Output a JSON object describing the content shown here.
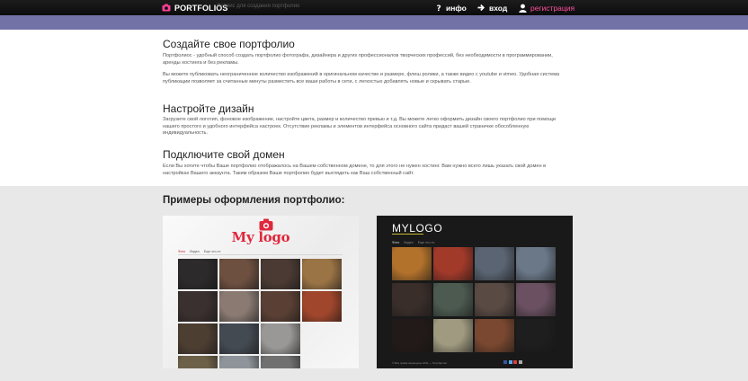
{
  "header": {
    "brand": "PORTFOLIOS",
    "tagline": "Сервис для создания портфолио",
    "nav": [
      {
        "label": "инфо",
        "icon": "question-icon"
      },
      {
        "label": "вход",
        "icon": "arrow-right-icon"
      },
      {
        "label": "регистрация",
        "icon": "user-icon"
      }
    ],
    "colors": {
      "topbar": "#111111",
      "band": "#7372a7",
      "register": "#ff4fa0"
    }
  },
  "sections": [
    {
      "title": "Создайте свое портфолио",
      "paragraphs": [
        "Портфолиос - удобный способ создать портфолио фотографа, дизайнера и других профессионалов творческих профессий, без необходимости в программировании, аренды хостинга и без рекламы.",
        "Вы можете публиковать неограниченное количество изображений в оригинальном качестве и размере, флеш ролики, а также видео с youtube и vimeo. Удобная система публикации позволяет за считанные минуты разместить все ваши работы в сети, с легкостью добавлять новые и скрывать старые."
      ]
    },
    {
      "title": "Настройте дизайн",
      "paragraphs": [
        "Загрузите свой логотип, фоновое изображение, настройте цвета, размер и количество превью и т.д. Вы можете легко оформить дизайн своего портфолио при помощи нашего простого и удобного интерфейса настроек. Отсутствие рекламы и элементов интерфейса основного сайта придаст вашей страничке обособленную индивидуальность."
      ]
    },
    {
      "title": "Подключите свой домен",
      "paragraphs": [
        "Если Вы хотите чтобы Ваше портфолио отображалось на Вашем собственном домене, то для этого не нужен хостинг. Вам нужно всего лишь указать свой домен в настройках Вашего аккаунта. Таким образом Ваше портфолио будет выглядеть как Ваш собственный сайт."
      ]
    }
  ],
  "examples": {
    "title": "Примеры оформления портфолио:",
    "light": {
      "logo": "My logo",
      "menu": [
        "Фото",
        "Видео",
        "Еще что-то"
      ],
      "thumb_colors": [
        "#2c2a2a",
        "#6e5040",
        "#4a3a33",
        "#9b7445",
        "#3b3030",
        "#8a7a72",
        "#5a4034",
        "#a0462c",
        "#4d3e32",
        "#444a52",
        "#9a9896",
        "#ffffff",
        "#6d6048",
        "#8e9499",
        "#707070",
        "#ffffff"
      ]
    },
    "dark": {
      "logo": "MYLOGO",
      "menu": [
        "Фото",
        "Видео",
        "Еще что-то"
      ],
      "thumb_colors": [
        "#b3722c",
        "#a23a2a",
        "#5a6472",
        "#6a7888",
        "#3a2e2a",
        "#4c5a50",
        "#5a4a44",
        "#6a5060",
        "#221a18",
        "#a09a80",
        "#7a4830",
        "#1e1e1e"
      ],
      "footer": "© Все права защищены 2011 — Портфолио"
    }
  }
}
